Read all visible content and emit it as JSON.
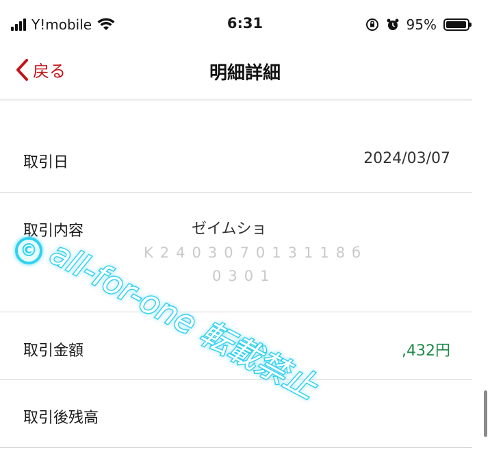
{
  "status_bar": {
    "carrier": "Y!mobile",
    "time": "6:31",
    "battery_percent": "95%",
    "battery_level": 0.95
  },
  "nav": {
    "back_label": "戻る",
    "title": "明細詳細"
  },
  "details": {
    "date_label": "取引日",
    "date_value": "2024/03/07",
    "content_label": "取引内容",
    "content_line1": "ゼイムショ",
    "content_line2": "K240307013118б",
    "content_line3": "0301",
    "amount_label": "取引金額",
    "amount_value": ",432円",
    "balance_label": "取引後残高"
  },
  "watermark": {
    "symbol": "©",
    "text": "all-for-one 転載禁止"
  },
  "colors": {
    "accent_red": "#c4121a",
    "amount_green": "#1f8a4a",
    "watermark_cyan": "#2fd2f0"
  }
}
